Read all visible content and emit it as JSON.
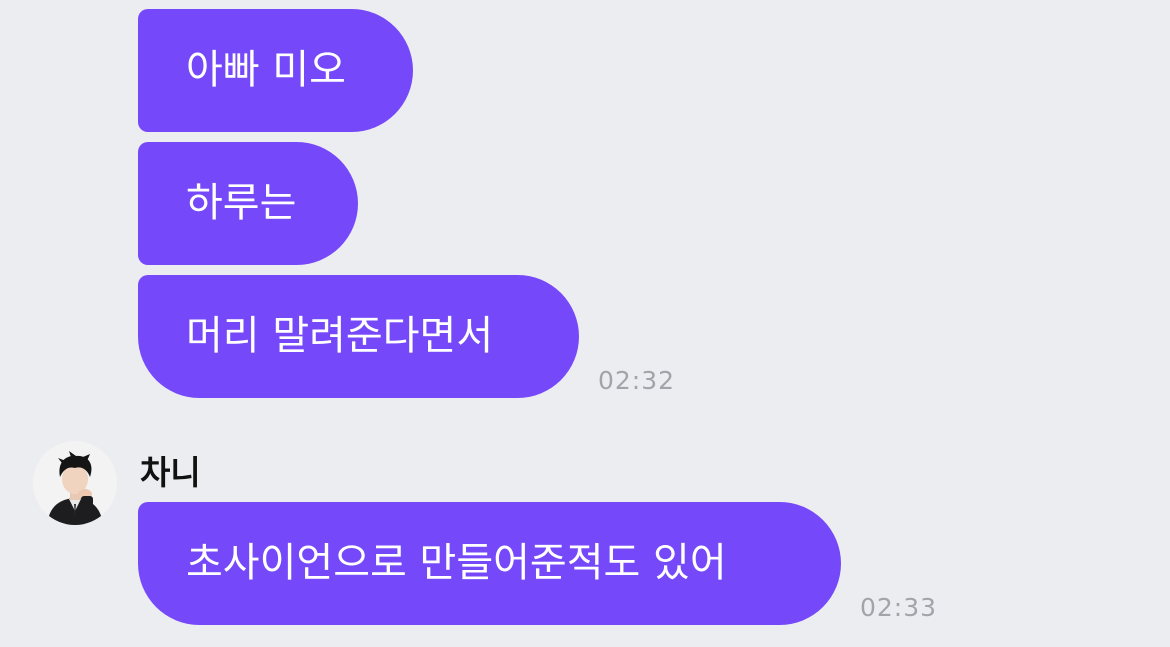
{
  "messages_top": [
    {
      "text": "아빠 미오"
    },
    {
      "text": "하루는"
    },
    {
      "text": "머리 말려준다면서",
      "time": "02:32"
    }
  ],
  "incoming": {
    "sender_name": "차니",
    "avatar_icon": "person-avatar-icon",
    "messages": [
      {
        "text": "초사이언으로 만들어준적도 있어",
        "time": "02:33"
      }
    ]
  },
  "colors": {
    "bubble": "#7549f9",
    "background": "#ecedf1",
    "timestamp": "#a3a4a9"
  }
}
